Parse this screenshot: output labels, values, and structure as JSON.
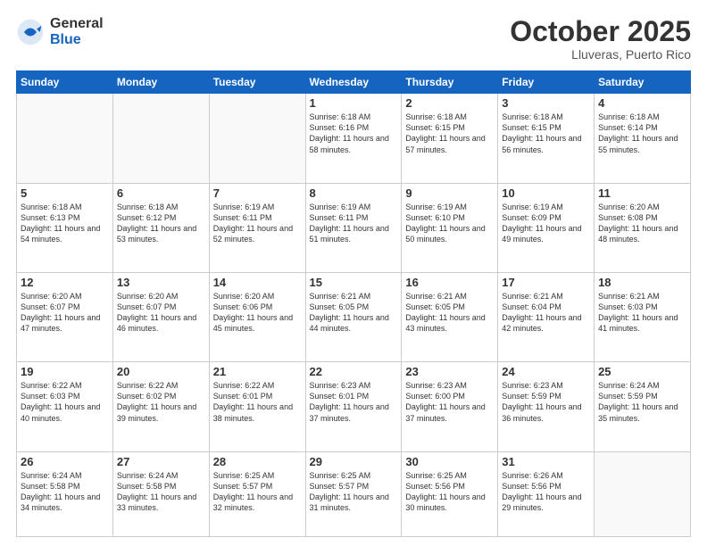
{
  "header": {
    "logo_general": "General",
    "logo_blue": "Blue",
    "month_year": "October 2025",
    "location": "Lluveras, Puerto Rico"
  },
  "weekdays": [
    "Sunday",
    "Monday",
    "Tuesday",
    "Wednesday",
    "Thursday",
    "Friday",
    "Saturday"
  ],
  "weeks": [
    [
      {
        "day": "",
        "info": ""
      },
      {
        "day": "",
        "info": ""
      },
      {
        "day": "",
        "info": ""
      },
      {
        "day": "1",
        "info": "Sunrise: 6:18 AM\nSunset: 6:16 PM\nDaylight: 11 hours\nand 58 minutes."
      },
      {
        "day": "2",
        "info": "Sunrise: 6:18 AM\nSunset: 6:15 PM\nDaylight: 11 hours\nand 57 minutes."
      },
      {
        "day": "3",
        "info": "Sunrise: 6:18 AM\nSunset: 6:15 PM\nDaylight: 11 hours\nand 56 minutes."
      },
      {
        "day": "4",
        "info": "Sunrise: 6:18 AM\nSunset: 6:14 PM\nDaylight: 11 hours\nand 55 minutes."
      }
    ],
    [
      {
        "day": "5",
        "info": "Sunrise: 6:18 AM\nSunset: 6:13 PM\nDaylight: 11 hours\nand 54 minutes."
      },
      {
        "day": "6",
        "info": "Sunrise: 6:18 AM\nSunset: 6:12 PM\nDaylight: 11 hours\nand 53 minutes."
      },
      {
        "day": "7",
        "info": "Sunrise: 6:19 AM\nSunset: 6:11 PM\nDaylight: 11 hours\nand 52 minutes."
      },
      {
        "day": "8",
        "info": "Sunrise: 6:19 AM\nSunset: 6:11 PM\nDaylight: 11 hours\nand 51 minutes."
      },
      {
        "day": "9",
        "info": "Sunrise: 6:19 AM\nSunset: 6:10 PM\nDaylight: 11 hours\nand 50 minutes."
      },
      {
        "day": "10",
        "info": "Sunrise: 6:19 AM\nSunset: 6:09 PM\nDaylight: 11 hours\nand 49 minutes."
      },
      {
        "day": "11",
        "info": "Sunrise: 6:20 AM\nSunset: 6:08 PM\nDaylight: 11 hours\nand 48 minutes."
      }
    ],
    [
      {
        "day": "12",
        "info": "Sunrise: 6:20 AM\nSunset: 6:07 PM\nDaylight: 11 hours\nand 47 minutes."
      },
      {
        "day": "13",
        "info": "Sunrise: 6:20 AM\nSunset: 6:07 PM\nDaylight: 11 hours\nand 46 minutes."
      },
      {
        "day": "14",
        "info": "Sunrise: 6:20 AM\nSunset: 6:06 PM\nDaylight: 11 hours\nand 45 minutes."
      },
      {
        "day": "15",
        "info": "Sunrise: 6:21 AM\nSunset: 6:05 PM\nDaylight: 11 hours\nand 44 minutes."
      },
      {
        "day": "16",
        "info": "Sunrise: 6:21 AM\nSunset: 6:05 PM\nDaylight: 11 hours\nand 43 minutes."
      },
      {
        "day": "17",
        "info": "Sunrise: 6:21 AM\nSunset: 6:04 PM\nDaylight: 11 hours\nand 42 minutes."
      },
      {
        "day": "18",
        "info": "Sunrise: 6:21 AM\nSunset: 6:03 PM\nDaylight: 11 hours\nand 41 minutes."
      }
    ],
    [
      {
        "day": "19",
        "info": "Sunrise: 6:22 AM\nSunset: 6:03 PM\nDaylight: 11 hours\nand 40 minutes."
      },
      {
        "day": "20",
        "info": "Sunrise: 6:22 AM\nSunset: 6:02 PM\nDaylight: 11 hours\nand 39 minutes."
      },
      {
        "day": "21",
        "info": "Sunrise: 6:22 AM\nSunset: 6:01 PM\nDaylight: 11 hours\nand 38 minutes."
      },
      {
        "day": "22",
        "info": "Sunrise: 6:23 AM\nSunset: 6:01 PM\nDaylight: 11 hours\nand 37 minutes."
      },
      {
        "day": "23",
        "info": "Sunrise: 6:23 AM\nSunset: 6:00 PM\nDaylight: 11 hours\nand 37 minutes."
      },
      {
        "day": "24",
        "info": "Sunrise: 6:23 AM\nSunset: 5:59 PM\nDaylight: 11 hours\nand 36 minutes."
      },
      {
        "day": "25",
        "info": "Sunrise: 6:24 AM\nSunset: 5:59 PM\nDaylight: 11 hours\nand 35 minutes."
      }
    ],
    [
      {
        "day": "26",
        "info": "Sunrise: 6:24 AM\nSunset: 5:58 PM\nDaylight: 11 hours\nand 34 minutes."
      },
      {
        "day": "27",
        "info": "Sunrise: 6:24 AM\nSunset: 5:58 PM\nDaylight: 11 hours\nand 33 minutes."
      },
      {
        "day": "28",
        "info": "Sunrise: 6:25 AM\nSunset: 5:57 PM\nDaylight: 11 hours\nand 32 minutes."
      },
      {
        "day": "29",
        "info": "Sunrise: 6:25 AM\nSunset: 5:57 PM\nDaylight: 11 hours\nand 31 minutes."
      },
      {
        "day": "30",
        "info": "Sunrise: 6:25 AM\nSunset: 5:56 PM\nDaylight: 11 hours\nand 30 minutes."
      },
      {
        "day": "31",
        "info": "Sunrise: 6:26 AM\nSunset: 5:56 PM\nDaylight: 11 hours\nand 29 minutes."
      },
      {
        "day": "",
        "info": ""
      }
    ]
  ]
}
